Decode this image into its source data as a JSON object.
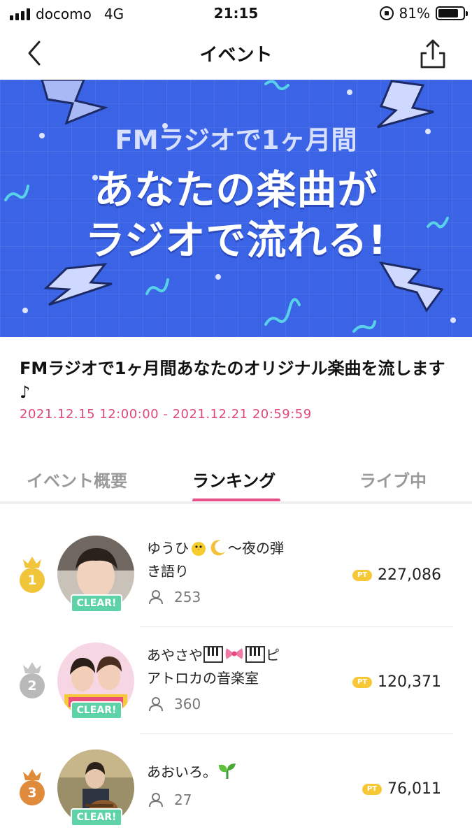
{
  "status_bar": {
    "carrier": "docomo",
    "network": "4G",
    "time": "21:15",
    "battery": "81%",
    "battery_level": 0.81
  },
  "nav": {
    "title": "イベント",
    "back_icon": "chevron-left-icon",
    "share_icon": "share-icon"
  },
  "banner": {
    "subtitle": "FMラジオで1ヶ月間",
    "line1": "あなたの楽曲が",
    "line2": "ラジオで流れる!",
    "background_color": "#3b63e6"
  },
  "event": {
    "title": "FMラジオで1ヶ月間あなたのオリジナル楽曲を流します♪",
    "period": "2021.12.15 12:00:00 - 2021.12.21 20:59:59"
  },
  "tabs": [
    {
      "label": "イベント概要",
      "active": false
    },
    {
      "label": "ランキング",
      "active": true
    },
    {
      "label": "ライブ中",
      "active": false
    }
  ],
  "ranking": [
    {
      "rank": "1",
      "medal_color": "#f0c53a",
      "name_line1": "ゆうひ",
      "name_line1_suffix": "〜夜の弾",
      "name_line2": "き語り",
      "emojis": [
        "chick-icon",
        "crescent-moon-icon"
      ],
      "listeners": "253",
      "points": "227,086",
      "badge": "CLEAR!"
    },
    {
      "rank": "2",
      "medal_color": "#b9b9b9",
      "name_line1": "あやさや",
      "name_line1_suffix": "ピ",
      "name_line2": "アトロカの音楽室",
      "emojis": [
        "piano-icon",
        "ribbon-icon",
        "piano-icon"
      ],
      "listeners": "360",
      "points": "120,371",
      "badge": "CLEAR!"
    },
    {
      "rank": "3",
      "medal_color": "#e08a3c",
      "name_line1": "あおいろ。",
      "name_line1_suffix": "",
      "name_line2": "",
      "emojis": [
        "seedling-icon"
      ],
      "listeners": "27",
      "points": "76,011",
      "badge": "CLEAR!"
    }
  ],
  "points_badge": "PT",
  "colors": {
    "accent": "#e8508a",
    "period": "#e0487b",
    "clear_badge": "#5fd3a8",
    "pt_badge": "#f7c738"
  }
}
